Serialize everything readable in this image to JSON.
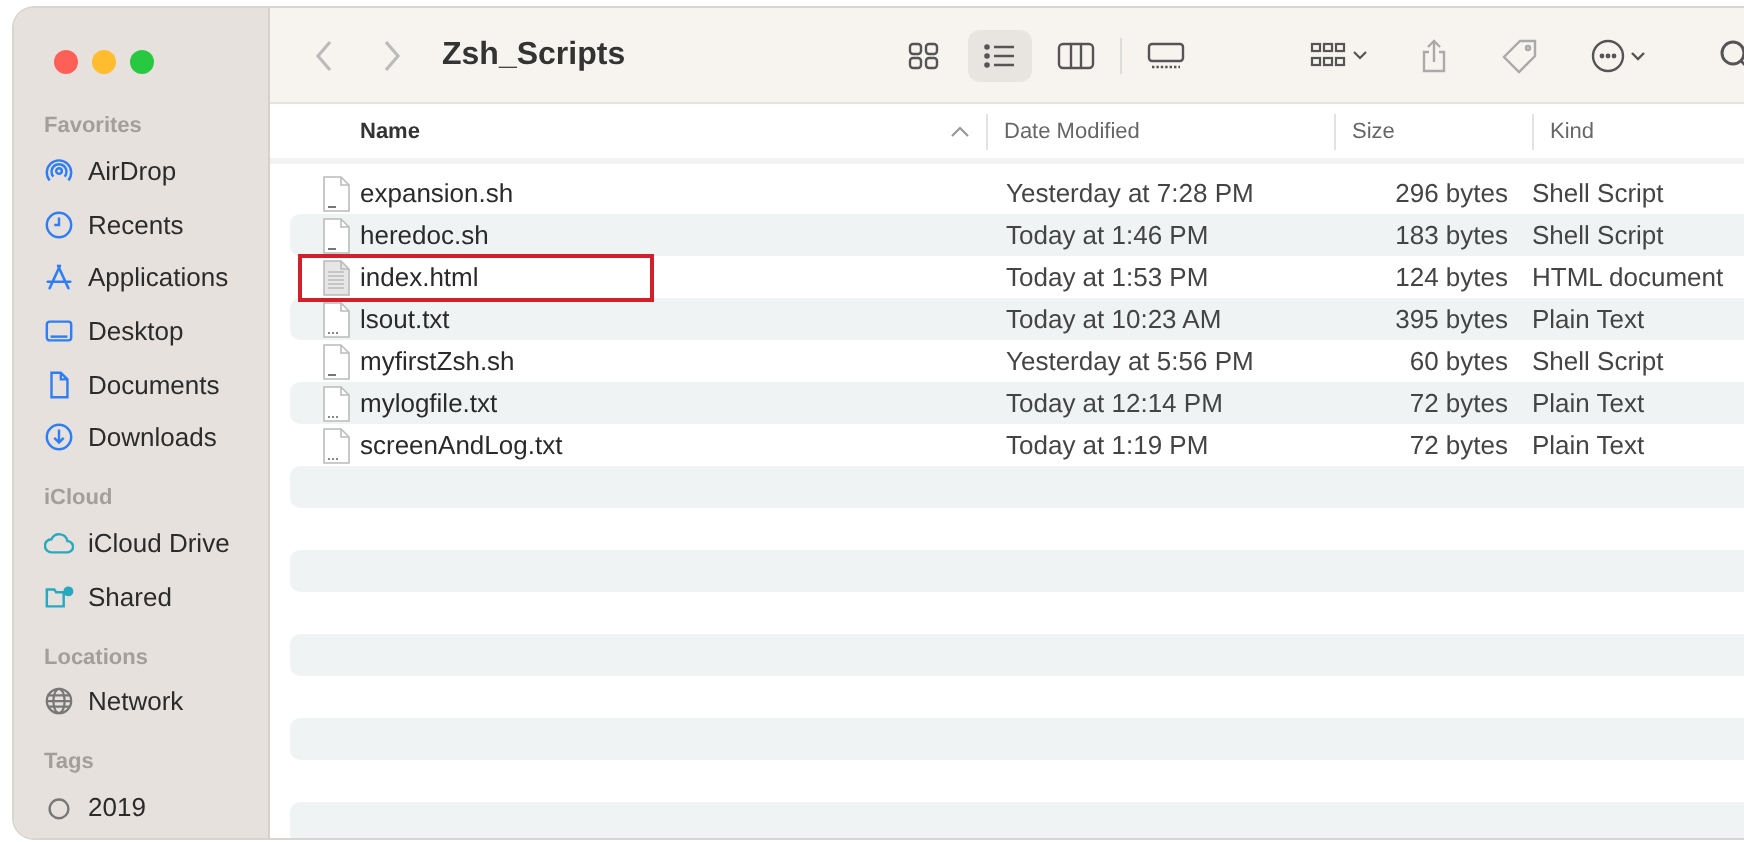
{
  "window": {
    "title": "Zsh_Scripts"
  },
  "toolbar": {
    "view_modes": [
      {
        "kind": "icons",
        "selected": false
      },
      {
        "kind": "list",
        "selected": true
      },
      {
        "kind": "columns",
        "selected": false
      },
      {
        "kind": "gallery",
        "selected": false
      }
    ]
  },
  "sidebar": {
    "sections": [
      {
        "title": "Favorites",
        "items": [
          {
            "label": "AirDrop",
            "kind": "airdrop"
          },
          {
            "label": "Recents",
            "kind": "clock"
          },
          {
            "label": "Applications",
            "kind": "apps"
          },
          {
            "label": "Desktop",
            "kind": "desktop"
          },
          {
            "label": "Documents",
            "kind": "document"
          },
          {
            "label": "Downloads",
            "kind": "download"
          }
        ]
      },
      {
        "title": "iCloud",
        "items": [
          {
            "label": "iCloud Drive",
            "kind": "cloud"
          },
          {
            "label": "Shared",
            "kind": "shared"
          }
        ]
      },
      {
        "title": "Locations",
        "items": [
          {
            "label": "Network",
            "kind": "globe"
          }
        ]
      },
      {
        "title": "Tags",
        "items": [
          {
            "label": "2019",
            "kind": "tag"
          }
        ]
      }
    ]
  },
  "table": {
    "columns": [
      {
        "label": "Name",
        "sorted": true
      },
      {
        "label": "Date Modified",
        "sorted": false
      },
      {
        "label": "Size",
        "sorted": false
      },
      {
        "label": "Kind",
        "sorted": false
      }
    ],
    "rows": [
      {
        "name": "expansion.sh",
        "date": "Yesterday at 7:28 PM",
        "size": "296 bytes",
        "kind_text": "Shell Script",
        "kind": "script",
        "highlighted": false
      },
      {
        "name": "heredoc.sh",
        "date": "Today at 1:46 PM",
        "size": "183 bytes",
        "kind_text": "Shell Script",
        "kind": "script",
        "highlighted": false
      },
      {
        "name": "index.html",
        "date": "Today at 1:53 PM",
        "size": "124 bytes",
        "kind_text": "HTML document",
        "kind": "html",
        "highlighted": true
      },
      {
        "name": "lsout.txt",
        "date": "Today at 10:23 AM",
        "size": "395 bytes",
        "kind_text": "Plain Text",
        "kind": "text",
        "highlighted": false
      },
      {
        "name": "myfirstZsh.sh",
        "date": "Yesterday at 5:56 PM",
        "size": "60 bytes",
        "kind_text": "Shell Script",
        "kind": "script",
        "highlighted": false
      },
      {
        "name": "mylogfile.txt",
        "date": "Today at 12:14 PM",
        "size": "72 bytes",
        "kind_text": "Plain Text",
        "kind": "text",
        "highlighted": false
      },
      {
        "name": "screenAndLog.txt",
        "date": "Today at 1:19 PM",
        "size": "72 bytes",
        "kind_text": "Plain Text",
        "kind": "text",
        "highlighted": false
      }
    ]
  }
}
